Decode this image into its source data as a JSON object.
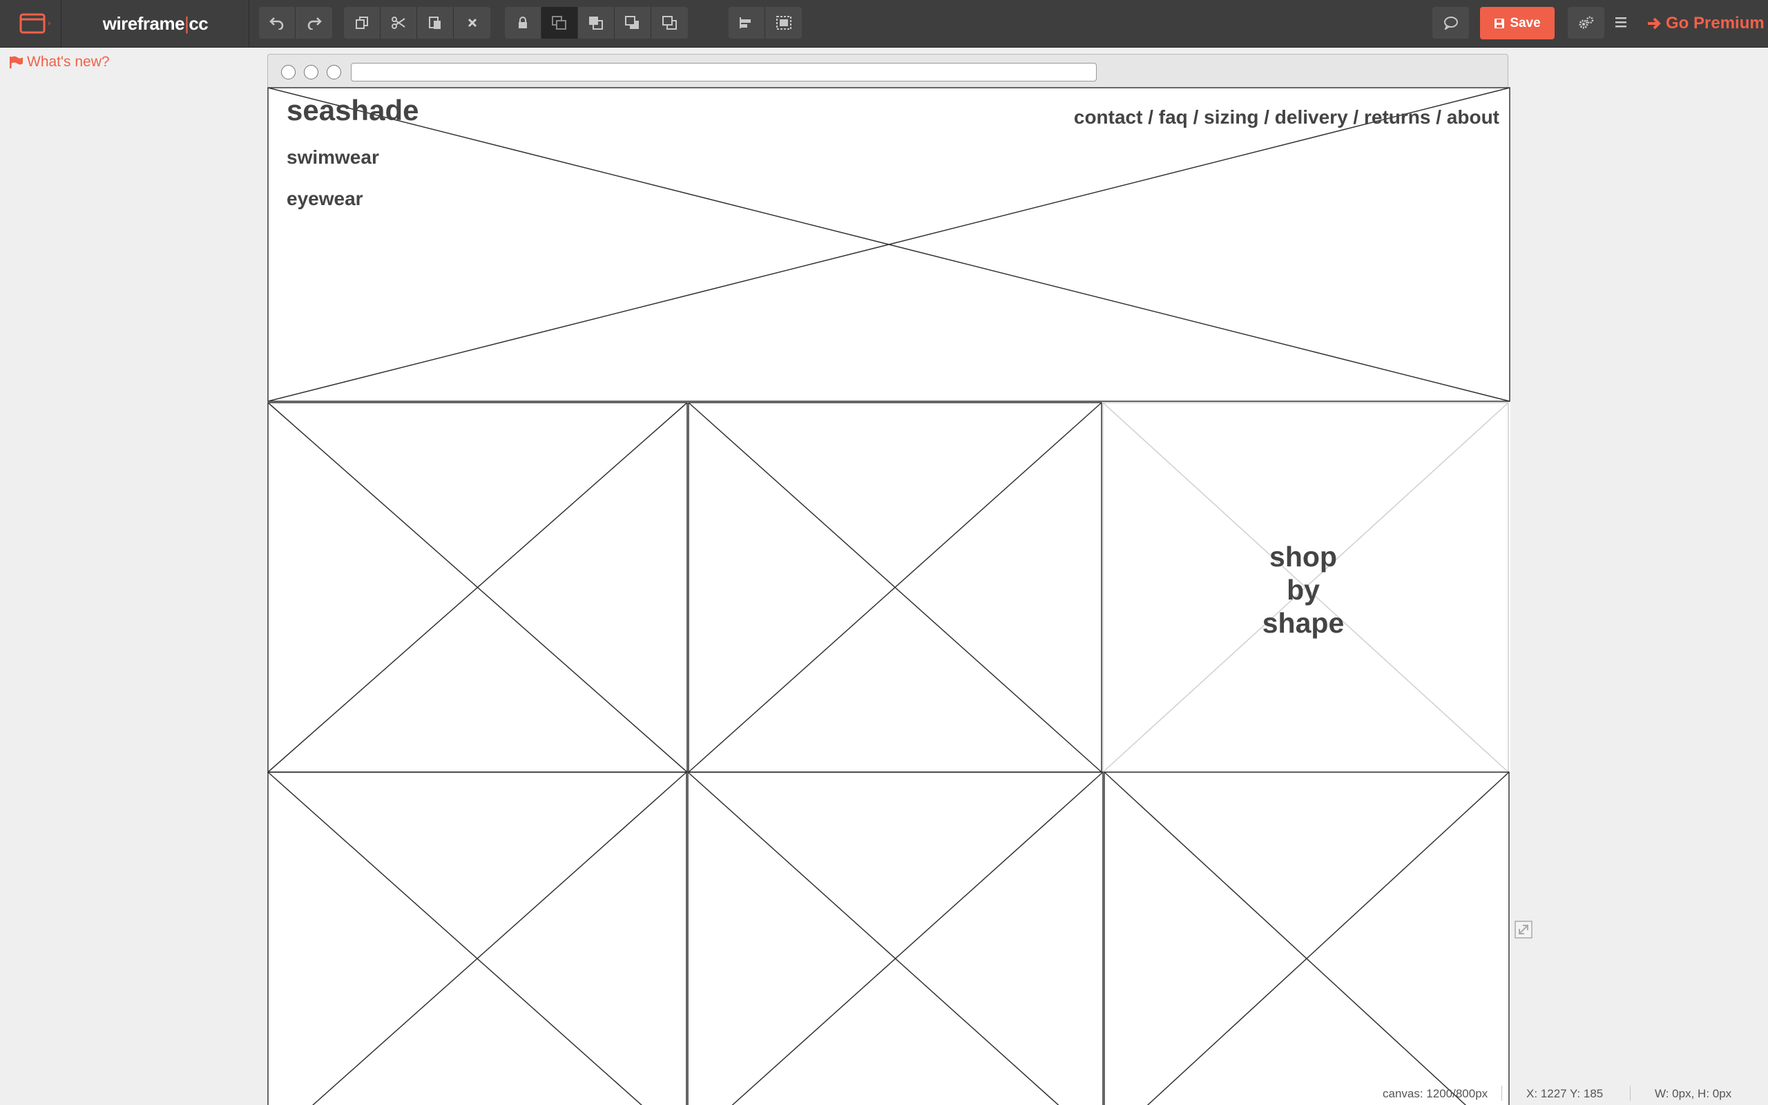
{
  "app": {
    "brand_main": "wireframe",
    "brand_sep": "|",
    "brand_suffix": "cc"
  },
  "toolbar": {
    "undo_icon": "undo-icon",
    "redo_icon": "redo-icon",
    "save_label": "Save",
    "premium_label": "Go Premium",
    "accent_color": "#f26149"
  },
  "whats_new_label": "What's new?",
  "wireframe": {
    "logo": "seashade",
    "nav": [
      "swimwear",
      "eyewear"
    ],
    "top_links": "contact / faq / sizing / delivery / returns / about",
    "shop_label_line1": "shop",
    "shop_label_line2": "by",
    "shop_label_line3": "shape"
  },
  "status": {
    "canvas": "canvas: 1200/800px",
    "coords": "X: 1227 Y: 185",
    "size": "W: 0px, H: 0px"
  }
}
